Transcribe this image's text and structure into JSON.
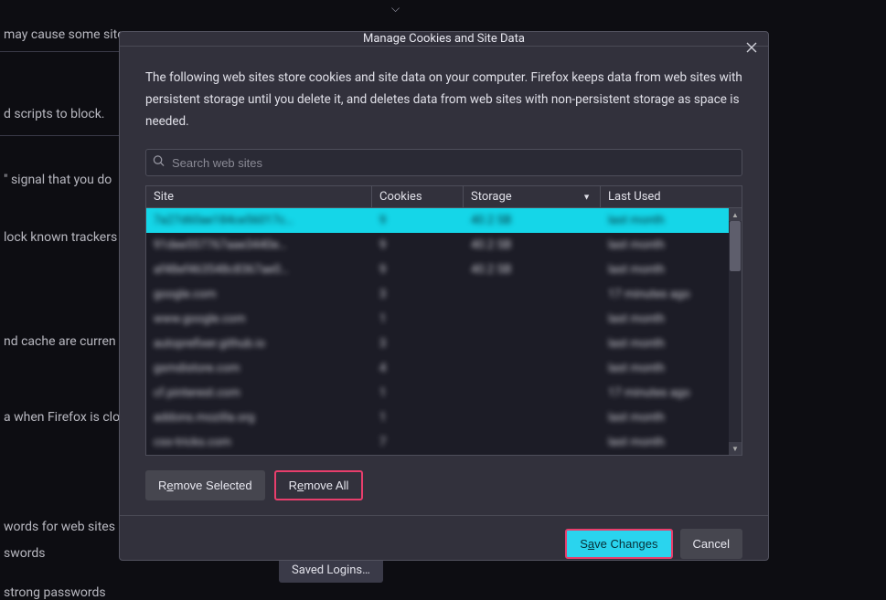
{
  "background": {
    "line1": "may cause some site",
    "line2": "d scripts to block.",
    "line3": "\" signal that you do",
    "line4": "lock known trackers",
    "line5": "nd cache are curren",
    "line6": "a when Firefox is clo",
    "line7": "words for web sites",
    "line8": "swords",
    "line9": "strong passwords",
    "saved_logins": "Saved Logins…"
  },
  "dialog": {
    "title": "Manage Cookies and Site Data",
    "description": "The following web sites store cookies and site data on your computer. Firefox keeps data from web sites with persistent storage until you delete it, and deletes data from web sites with non-persistent storage as space is needed.",
    "search_placeholder": "Search web sites"
  },
  "columns": {
    "site": "Site",
    "cookies": "Cookies",
    "storage": "Storage",
    "last_used": "Last Used"
  },
  "rows": [
    {
      "site": "7a27d60ae184ce56017c…",
      "cookies": "9",
      "storage": "40.2 SB",
      "last_used": "last month"
    },
    {
      "site": "91dee557767aae3440e…",
      "cookies": "9",
      "storage": "40.2 SB",
      "last_used": "last month"
    },
    {
      "site": "af48ef463548c8367ae0…",
      "cookies": "9",
      "storage": "40.2 SB",
      "last_used": "last month"
    },
    {
      "site": "google.com",
      "cookies": "3",
      "storage": "",
      "last_used": "17 minutes ago"
    },
    {
      "site": "www.google.com",
      "cookies": "1",
      "storage": "",
      "last_used": "last month"
    },
    {
      "site": "autoprefixer.github.io",
      "cookies": "3",
      "storage": "",
      "last_used": "last month"
    },
    {
      "site": "gsmdistore.com",
      "cookies": "4",
      "storage": "",
      "last_used": "last month"
    },
    {
      "site": "cf.pinterest.com",
      "cookies": "1",
      "storage": "",
      "last_used": "17 minutes ago"
    },
    {
      "site": "addons.mozilla.org",
      "cookies": "1",
      "storage": "",
      "last_used": "last month"
    },
    {
      "site": "css-tricks.com",
      "cookies": "7",
      "storage": "",
      "last_used": "last month"
    }
  ],
  "buttons": {
    "remove_selected_pre": "R",
    "remove_selected_u": "e",
    "remove_selected_post": "move Selected",
    "remove_all_pre": "R",
    "remove_all_u": "e",
    "remove_all_post": "move All",
    "save_pre": "S",
    "save_u": "a",
    "save_post": "ve Changes",
    "cancel": "Cancel"
  }
}
